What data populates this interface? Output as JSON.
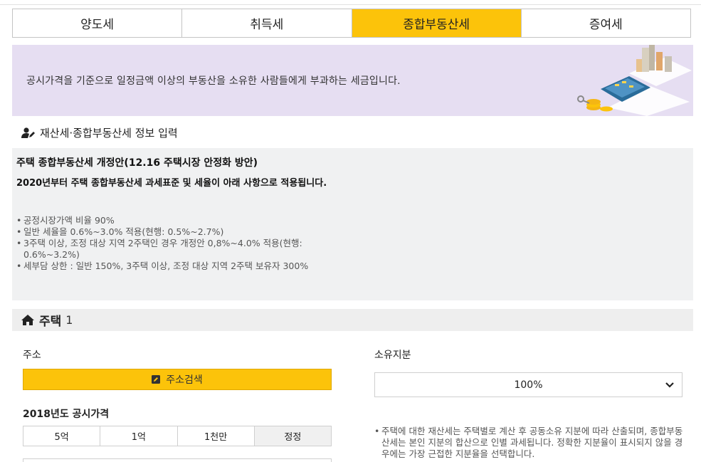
{
  "tabs": [
    {
      "label": "양도세"
    },
    {
      "label": "취득세"
    },
    {
      "label": "종합부동산세",
      "active": true
    },
    {
      "label": "증여세"
    }
  ],
  "banner": {
    "text": "공시가격을 기준으로 일정금액 이상의 부동산을 소유한 사람들에게 부과하는 세금입니다."
  },
  "section": {
    "title": "재산세·종합부동산세 정보 입력"
  },
  "notice": {
    "title": "주택 종합부동산세 개정안(12.16 주택시장 안정화 방안)",
    "subtitle": "2020년부터 주택 종합부동산세 과세표준 및 세율이 아래 사항으로 적용됩니다.",
    "items": [
      "공정시장가액 비율 90%",
      "일반 세율을 0.6%~3.0% 적용(현행: 0.5%~2.7%)",
      "3주택 이상, 조정 대상 지역 2주택인 경우 개정안 0,8%~4.0% 적용(현행: 0.6%~3.2%)",
      "세부담 상한 : 일반 150%, 3주택 이상, 조정 대상 지역 2주택 보유자 300%"
    ]
  },
  "house": {
    "title": "주택",
    "number": "1"
  },
  "form": {
    "address_label": "주소",
    "address_button": "주소검색",
    "share_label": "소유지분",
    "share_value": "100%",
    "price_label": "2018년도 공시가격",
    "amount_buttons": [
      "5억",
      "1억",
      "1천만",
      "정정"
    ],
    "share_note": "주택에 대한 재산세는 주택별로 계산 후 공동소유 지분에 따라 산출되며, 종합부동산세는 본인 지분의 합산으로 인별 과세됩니다. 정확한 지분율이 표시되지 않을 경우에는 가장 근접한 지분율을 선택합니다."
  },
  "colors": {
    "accent": "#fcc30a",
    "banner_bg": "#e6def2",
    "notice_bg": "#f0f1f2"
  }
}
